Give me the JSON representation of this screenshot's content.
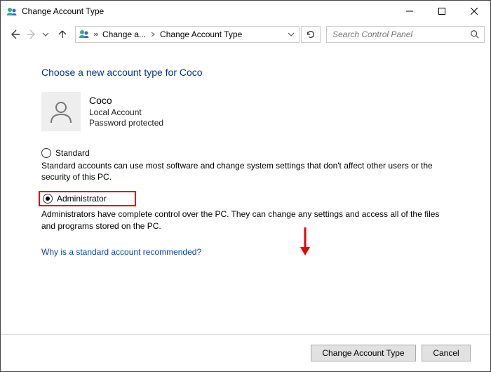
{
  "window": {
    "title": "Change Account Type"
  },
  "nav": {
    "crumb1": "Change a...",
    "crumb2": "Change Account Type"
  },
  "search": {
    "placeholder": "Search Control Panel"
  },
  "heading": "Choose a new account type for Coco",
  "user": {
    "name": "Coco",
    "line1": "Local Account",
    "line2": "Password protected"
  },
  "options": {
    "standard": {
      "label": "Standard",
      "desc": "Standard accounts can use most software and change system settings that don't affect other users or the security of this PC.",
      "selected": false
    },
    "administrator": {
      "label": "Administrator",
      "desc": "Administrators have complete control over the PC. They can change any settings and access all of the files and programs stored on the PC.",
      "selected": true
    }
  },
  "link": "Why is a standard account recommended?",
  "buttons": {
    "change": "Change Account Type",
    "cancel": "Cancel"
  },
  "annotation": {
    "hint_color": "#d00"
  }
}
